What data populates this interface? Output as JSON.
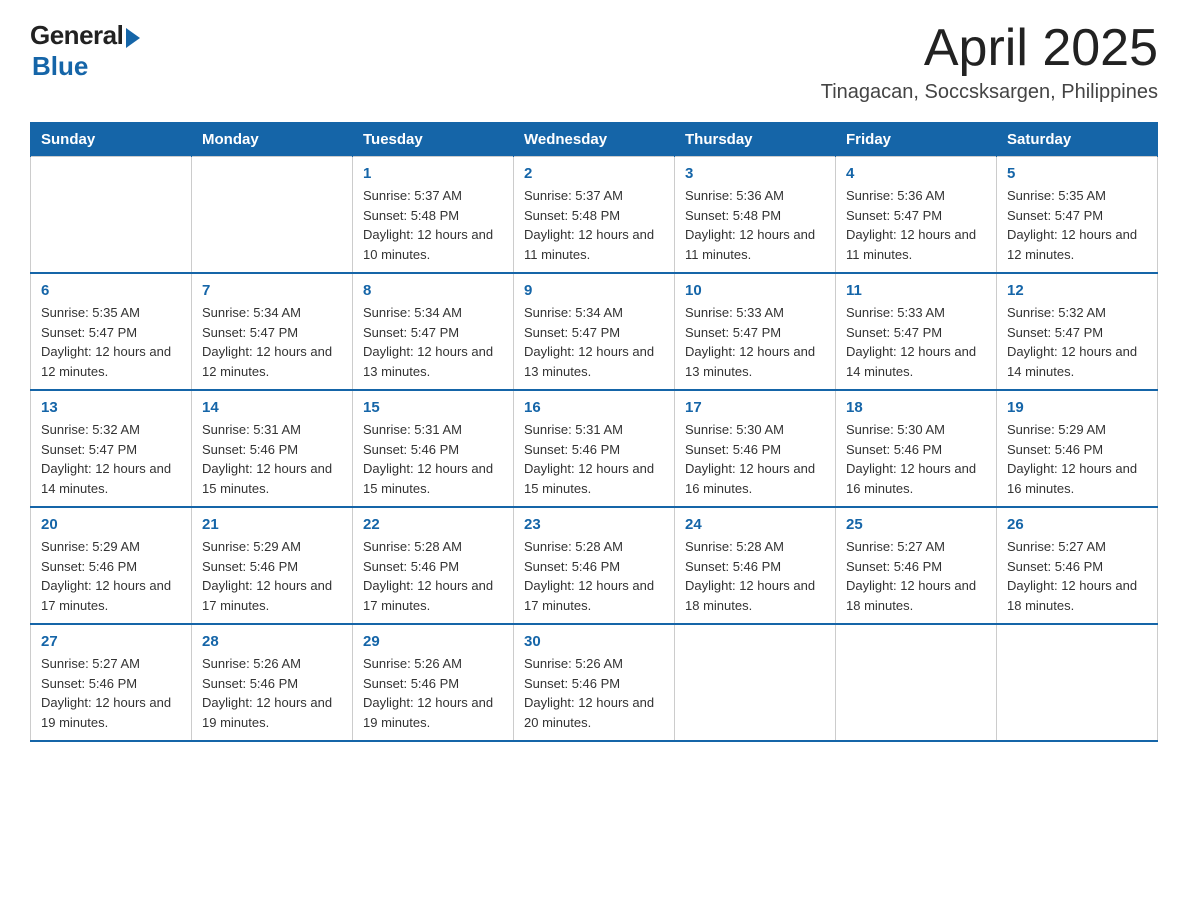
{
  "logo": {
    "general": "General",
    "blue": "Blue"
  },
  "header": {
    "month_year": "April 2025",
    "location": "Tinagacan, Soccsksargen, Philippines"
  },
  "weekdays": [
    "Sunday",
    "Monday",
    "Tuesday",
    "Wednesday",
    "Thursday",
    "Friday",
    "Saturday"
  ],
  "weeks": [
    [
      {
        "day": "",
        "sunrise": "",
        "sunset": "",
        "daylight": ""
      },
      {
        "day": "",
        "sunrise": "",
        "sunset": "",
        "daylight": ""
      },
      {
        "day": "1",
        "sunrise": "Sunrise: 5:37 AM",
        "sunset": "Sunset: 5:48 PM",
        "daylight": "Daylight: 12 hours and 10 minutes."
      },
      {
        "day": "2",
        "sunrise": "Sunrise: 5:37 AM",
        "sunset": "Sunset: 5:48 PM",
        "daylight": "Daylight: 12 hours and 11 minutes."
      },
      {
        "day": "3",
        "sunrise": "Sunrise: 5:36 AM",
        "sunset": "Sunset: 5:48 PM",
        "daylight": "Daylight: 12 hours and 11 minutes."
      },
      {
        "day": "4",
        "sunrise": "Sunrise: 5:36 AM",
        "sunset": "Sunset: 5:47 PM",
        "daylight": "Daylight: 12 hours and 11 minutes."
      },
      {
        "day": "5",
        "sunrise": "Sunrise: 5:35 AM",
        "sunset": "Sunset: 5:47 PM",
        "daylight": "Daylight: 12 hours and 12 minutes."
      }
    ],
    [
      {
        "day": "6",
        "sunrise": "Sunrise: 5:35 AM",
        "sunset": "Sunset: 5:47 PM",
        "daylight": "Daylight: 12 hours and 12 minutes."
      },
      {
        "day": "7",
        "sunrise": "Sunrise: 5:34 AM",
        "sunset": "Sunset: 5:47 PM",
        "daylight": "Daylight: 12 hours and 12 minutes."
      },
      {
        "day": "8",
        "sunrise": "Sunrise: 5:34 AM",
        "sunset": "Sunset: 5:47 PM",
        "daylight": "Daylight: 12 hours and 13 minutes."
      },
      {
        "day": "9",
        "sunrise": "Sunrise: 5:34 AM",
        "sunset": "Sunset: 5:47 PM",
        "daylight": "Daylight: 12 hours and 13 minutes."
      },
      {
        "day": "10",
        "sunrise": "Sunrise: 5:33 AM",
        "sunset": "Sunset: 5:47 PM",
        "daylight": "Daylight: 12 hours and 13 minutes."
      },
      {
        "day": "11",
        "sunrise": "Sunrise: 5:33 AM",
        "sunset": "Sunset: 5:47 PM",
        "daylight": "Daylight: 12 hours and 14 minutes."
      },
      {
        "day": "12",
        "sunrise": "Sunrise: 5:32 AM",
        "sunset": "Sunset: 5:47 PM",
        "daylight": "Daylight: 12 hours and 14 minutes."
      }
    ],
    [
      {
        "day": "13",
        "sunrise": "Sunrise: 5:32 AM",
        "sunset": "Sunset: 5:47 PM",
        "daylight": "Daylight: 12 hours and 14 minutes."
      },
      {
        "day": "14",
        "sunrise": "Sunrise: 5:31 AM",
        "sunset": "Sunset: 5:46 PM",
        "daylight": "Daylight: 12 hours and 15 minutes."
      },
      {
        "day": "15",
        "sunrise": "Sunrise: 5:31 AM",
        "sunset": "Sunset: 5:46 PM",
        "daylight": "Daylight: 12 hours and 15 minutes."
      },
      {
        "day": "16",
        "sunrise": "Sunrise: 5:31 AM",
        "sunset": "Sunset: 5:46 PM",
        "daylight": "Daylight: 12 hours and 15 minutes."
      },
      {
        "day": "17",
        "sunrise": "Sunrise: 5:30 AM",
        "sunset": "Sunset: 5:46 PM",
        "daylight": "Daylight: 12 hours and 16 minutes."
      },
      {
        "day": "18",
        "sunrise": "Sunrise: 5:30 AM",
        "sunset": "Sunset: 5:46 PM",
        "daylight": "Daylight: 12 hours and 16 minutes."
      },
      {
        "day": "19",
        "sunrise": "Sunrise: 5:29 AM",
        "sunset": "Sunset: 5:46 PM",
        "daylight": "Daylight: 12 hours and 16 minutes."
      }
    ],
    [
      {
        "day": "20",
        "sunrise": "Sunrise: 5:29 AM",
        "sunset": "Sunset: 5:46 PM",
        "daylight": "Daylight: 12 hours and 17 minutes."
      },
      {
        "day": "21",
        "sunrise": "Sunrise: 5:29 AM",
        "sunset": "Sunset: 5:46 PM",
        "daylight": "Daylight: 12 hours and 17 minutes."
      },
      {
        "day": "22",
        "sunrise": "Sunrise: 5:28 AM",
        "sunset": "Sunset: 5:46 PM",
        "daylight": "Daylight: 12 hours and 17 minutes."
      },
      {
        "day": "23",
        "sunrise": "Sunrise: 5:28 AM",
        "sunset": "Sunset: 5:46 PM",
        "daylight": "Daylight: 12 hours and 17 minutes."
      },
      {
        "day": "24",
        "sunrise": "Sunrise: 5:28 AM",
        "sunset": "Sunset: 5:46 PM",
        "daylight": "Daylight: 12 hours and 18 minutes."
      },
      {
        "day": "25",
        "sunrise": "Sunrise: 5:27 AM",
        "sunset": "Sunset: 5:46 PM",
        "daylight": "Daylight: 12 hours and 18 minutes."
      },
      {
        "day": "26",
        "sunrise": "Sunrise: 5:27 AM",
        "sunset": "Sunset: 5:46 PM",
        "daylight": "Daylight: 12 hours and 18 minutes."
      }
    ],
    [
      {
        "day": "27",
        "sunrise": "Sunrise: 5:27 AM",
        "sunset": "Sunset: 5:46 PM",
        "daylight": "Daylight: 12 hours and 19 minutes."
      },
      {
        "day": "28",
        "sunrise": "Sunrise: 5:26 AM",
        "sunset": "Sunset: 5:46 PM",
        "daylight": "Daylight: 12 hours and 19 minutes."
      },
      {
        "day": "29",
        "sunrise": "Sunrise: 5:26 AM",
        "sunset": "Sunset: 5:46 PM",
        "daylight": "Daylight: 12 hours and 19 minutes."
      },
      {
        "day": "30",
        "sunrise": "Sunrise: 5:26 AM",
        "sunset": "Sunset: 5:46 PM",
        "daylight": "Daylight: 12 hours and 20 minutes."
      },
      {
        "day": "",
        "sunrise": "",
        "sunset": "",
        "daylight": ""
      },
      {
        "day": "",
        "sunrise": "",
        "sunset": "",
        "daylight": ""
      },
      {
        "day": "",
        "sunrise": "",
        "sunset": "",
        "daylight": ""
      }
    ]
  ]
}
